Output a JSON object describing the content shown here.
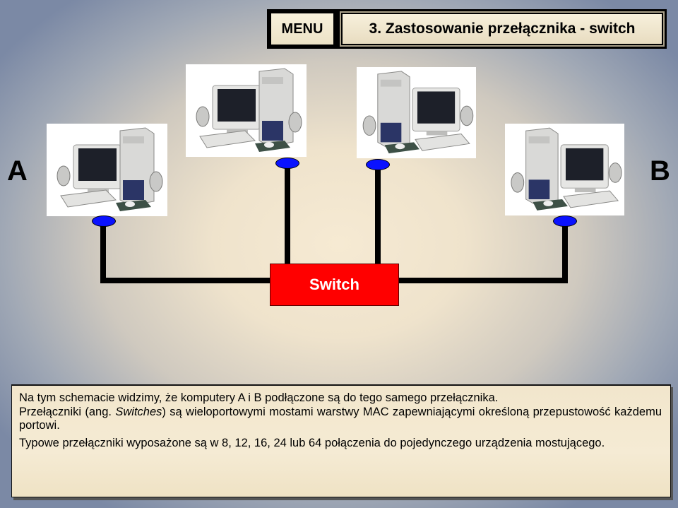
{
  "header": {
    "menu_label": "MENU",
    "title": "3. Zastosowanie przełącznika - switch"
  },
  "diagram": {
    "label_left": "A",
    "label_right": "B",
    "switch_label": "Switch",
    "computers": [
      {
        "id": "computer-a",
        "icon": "desktop-computer-icon"
      },
      {
        "id": "computer-2",
        "icon": "desktop-computer-icon"
      },
      {
        "id": "computer-3",
        "icon": "desktop-computer-icon"
      },
      {
        "id": "computer-b",
        "icon": "desktop-computer-icon"
      }
    ],
    "colors": {
      "switch": "#ff0000",
      "port": "#0a12ff",
      "wire": "#000000"
    }
  },
  "description": {
    "p1": "Na tym schemacie widzimy, że komputery A i B  podłączone są do tego samego przełącznika.",
    "p2_before": "Przełączniki (ang. ",
    "p2_italic": "Switches",
    "p2_after": ") są wieloportowymi mostami warstwy MAC zapewniającymi określoną przepustowość każdemu portowi.",
    "p3": "Typowe przełączniki wyposażone są w 8, 12, 16, 24 lub 64 połączenia do pojedynczego urządzenia mostującego."
  }
}
